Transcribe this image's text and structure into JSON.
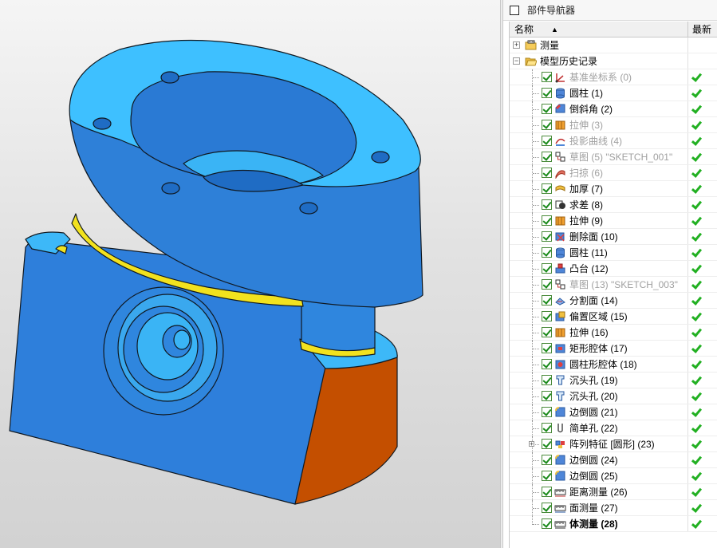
{
  "viewport": {
    "model_colors": {
      "top_face": "#3ec0ff",
      "side_face": "#2e80d8",
      "cut_face": "#c85000",
      "fillet": "#f0e020",
      "edge": "#101820"
    }
  },
  "navigator": {
    "title": "部件导航器",
    "columns": {
      "name": "名称",
      "latest": "最新"
    },
    "top_nodes": [
      {
        "label": "测量",
        "expander": "+",
        "icon": "measure-folder-icon"
      },
      {
        "label": "模型历史记录",
        "expander": "−",
        "icon": "folder-open-icon"
      }
    ],
    "features": [
      {
        "label": "基准坐标系 (0)",
        "icon": "datum-csys-icon",
        "dim": true,
        "bold": false,
        "latest": true
      },
      {
        "label": "圆柱 (1)",
        "icon": "cylinder-icon",
        "dim": false,
        "bold": false,
        "latest": true
      },
      {
        "label": "倒斜角 (2)",
        "icon": "chamfer-icon",
        "dim": false,
        "bold": false,
        "latest": true
      },
      {
        "label": "拉伸 (3)",
        "icon": "extrude-icon",
        "dim": true,
        "bold": false,
        "latest": true
      },
      {
        "label": "投影曲线 (4)",
        "icon": "project-curve-icon",
        "dim": true,
        "bold": false,
        "latest": true
      },
      {
        "label": "草图 (5) \"SKETCH_001\"",
        "icon": "sketch-icon",
        "dim": true,
        "bold": false,
        "latest": true
      },
      {
        "label": "扫掠 (6)",
        "icon": "swept-icon",
        "dim": true,
        "bold": false,
        "latest": true
      },
      {
        "label": "加厚 (7)",
        "icon": "thicken-icon",
        "dim": false,
        "bold": false,
        "latest": true
      },
      {
        "label": "求差 (8)",
        "icon": "subtract-icon",
        "dim": false,
        "bold": false,
        "latest": true
      },
      {
        "label": "拉伸 (9)",
        "icon": "extrude-icon",
        "dim": false,
        "bold": false,
        "latest": true
      },
      {
        "label": "删除面 (10)",
        "icon": "delete-face-icon",
        "dim": false,
        "bold": false,
        "latest": true
      },
      {
        "label": "圆柱 (11)",
        "icon": "cylinder-icon",
        "dim": false,
        "bold": false,
        "latest": true
      },
      {
        "label": "凸台 (12)",
        "icon": "boss-icon",
        "dim": false,
        "bold": false,
        "latest": true
      },
      {
        "label": "草图 (13) \"SKETCH_003\"",
        "icon": "sketch-icon",
        "dim": true,
        "bold": false,
        "latest": true
      },
      {
        "label": "分割面 (14)",
        "icon": "divide-face-icon",
        "dim": false,
        "bold": false,
        "latest": true
      },
      {
        "label": "偏置区域 (15)",
        "icon": "offset-region-icon",
        "dim": false,
        "bold": false,
        "latest": true
      },
      {
        "label": "拉伸 (16)",
        "icon": "extrude-icon",
        "dim": false,
        "bold": false,
        "latest": true
      },
      {
        "label": "矩形腔体 (17)",
        "icon": "rect-pocket-icon",
        "dim": false,
        "bold": false,
        "latest": true
      },
      {
        "label": "圆柱形腔体 (18)",
        "icon": "cyl-pocket-icon",
        "dim": false,
        "bold": false,
        "latest": true
      },
      {
        "label": "沉头孔 (19)",
        "icon": "counterbore-icon",
        "dim": false,
        "bold": false,
        "latest": true
      },
      {
        "label": "沉头孔 (20)",
        "icon": "counterbore-icon",
        "dim": false,
        "bold": false,
        "latest": true
      },
      {
        "label": "边倒圆 (21)",
        "icon": "edge-blend-icon",
        "dim": false,
        "bold": false,
        "latest": true
      },
      {
        "label": "简单孔 (22)",
        "icon": "simple-hole-icon",
        "dim": false,
        "bold": false,
        "latest": true
      },
      {
        "label": "阵列特征 [圆形] (23)",
        "icon": "pattern-icon",
        "dim": false,
        "bold": false,
        "latest": true,
        "expander": "+"
      },
      {
        "label": "边倒圆 (24)",
        "icon": "edge-blend-icon",
        "dim": false,
        "bold": false,
        "latest": true
      },
      {
        "label": "边倒圆 (25)",
        "icon": "edge-blend-icon",
        "dim": false,
        "bold": false,
        "latest": true
      },
      {
        "label": "距离测量 (26)",
        "icon": "distance-measure-icon",
        "dim": false,
        "bold": false,
        "latest": true
      },
      {
        "label": "面测量 (27)",
        "icon": "area-measure-icon",
        "dim": false,
        "bold": false,
        "latest": true
      },
      {
        "label": "体测量 (28)",
        "icon": "body-measure-icon",
        "dim": false,
        "bold": true,
        "latest": true
      }
    ]
  }
}
